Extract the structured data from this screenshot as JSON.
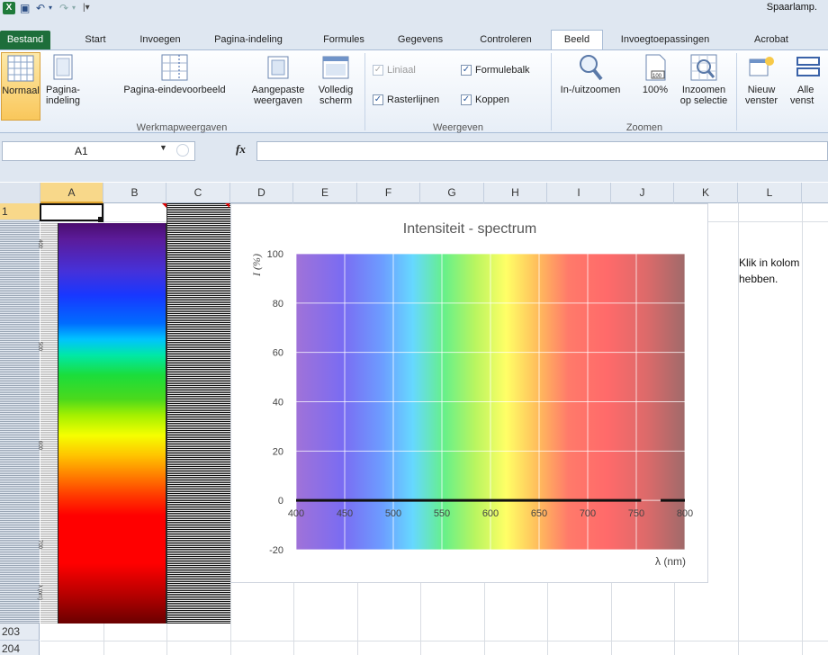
{
  "qat": {
    "title": "Spaarlamp."
  },
  "tabs": [
    "Bestand",
    "Start",
    "Invoegen",
    "Pagina-indeling",
    "Formules",
    "Gegevens",
    "Controleren",
    "Beeld",
    "Invoegtoepassingen",
    "Acrobat"
  ],
  "ribbon": {
    "normaal": "Normaal",
    "pagina_1": "Pagina-",
    "pagina_2": "indeling",
    "eindevoorbeeld": "Pagina-eindevoorbeeld",
    "aangepaste_1": "Aangepaste",
    "aangepaste_2": "weergaven",
    "volledig_1": "Volledig",
    "volledig_2": "scherm",
    "grp_werkmap": "Werkmapweergaven",
    "liniaal": "Liniaal",
    "formulebalk": "Formulebalk",
    "rasterlijnen": "Rasterlijnen",
    "koppen": "Koppen",
    "grp_weergeven": "Weergeven",
    "inuitzoomen": "In-/uitzoomen",
    "pct100": "100%",
    "inzoomen_1": "Inzoomen",
    "inzoomen_2": "op selectie",
    "grp_zoomen": "Zoomen",
    "nieuw_1": "Nieuw",
    "nieuw_2": "venster",
    "alle_1": "Alle",
    "alle_2": "venst"
  },
  "formula_bar": {
    "name_box": "A1",
    "fx": "fx",
    "value": ""
  },
  "columns": [
    "A",
    "B",
    "C",
    "D",
    "E",
    "F",
    "G",
    "H",
    "I",
    "J",
    "K",
    "L"
  ],
  "rows": {
    "first": "1",
    "r203": "203",
    "r204": "204"
  },
  "spectrum_labels": [
    "400",
    "500",
    "600",
    "700",
    "λ (nm)"
  ],
  "note": {
    "line1": "Klik in kolom",
    "line2": "hebben."
  },
  "colors": {
    "file_tab": "#1d6e3a",
    "selected": "#f8d88a",
    "series": "#111111"
  },
  "chart_data": {
    "type": "line",
    "title": "Intensiteit - spectrum",
    "xlabel": "λ (nm)",
    "ylabel": "I (%)",
    "xlim": [
      400,
      800
    ],
    "ylim": [
      -20,
      100
    ],
    "xticks": [
      400,
      450,
      500,
      550,
      600,
      650,
      700,
      750,
      800
    ],
    "yticks": [
      -20,
      0,
      20,
      40,
      60,
      80,
      100
    ],
    "grid": true,
    "background": "visible spectrum gradient",
    "series": [
      {
        "x": [
          400,
          450,
          500,
          550,
          600,
          650,
          700,
          755,
          760,
          775,
          785,
          795,
          800
        ],
        "y": [
          0,
          0,
          0,
          0,
          0,
          0,
          0,
          0,
          null,
          0,
          0,
          0,
          0
        ]
      }
    ]
  }
}
